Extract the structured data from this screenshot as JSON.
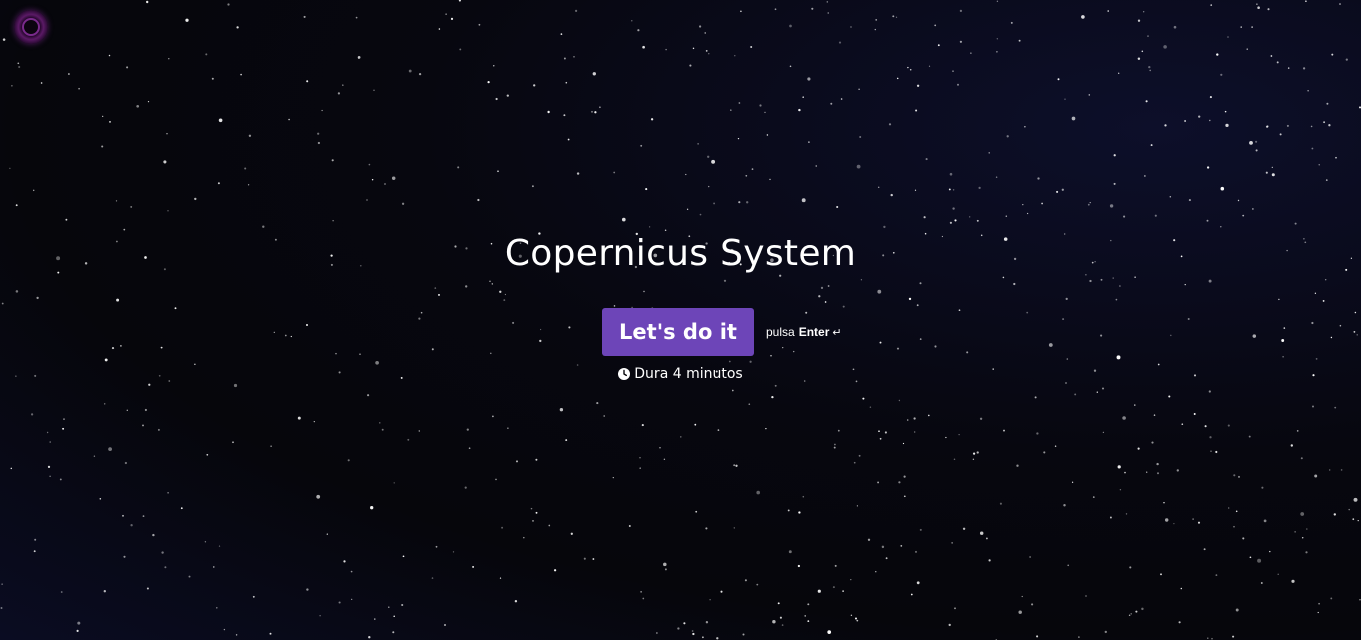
{
  "page": {
    "title": "Copernicus System"
  },
  "cta": {
    "label": "Let's do it",
    "color": "#6d45b8"
  },
  "hint": {
    "prefix": "pulsa",
    "key": "Enter",
    "icon": "enter-return-icon",
    "glyph": "↵"
  },
  "duration": {
    "icon": "clock-icon",
    "text": "Dura 4 minutos"
  },
  "logo": {
    "icon": "ring-logo-icon"
  }
}
